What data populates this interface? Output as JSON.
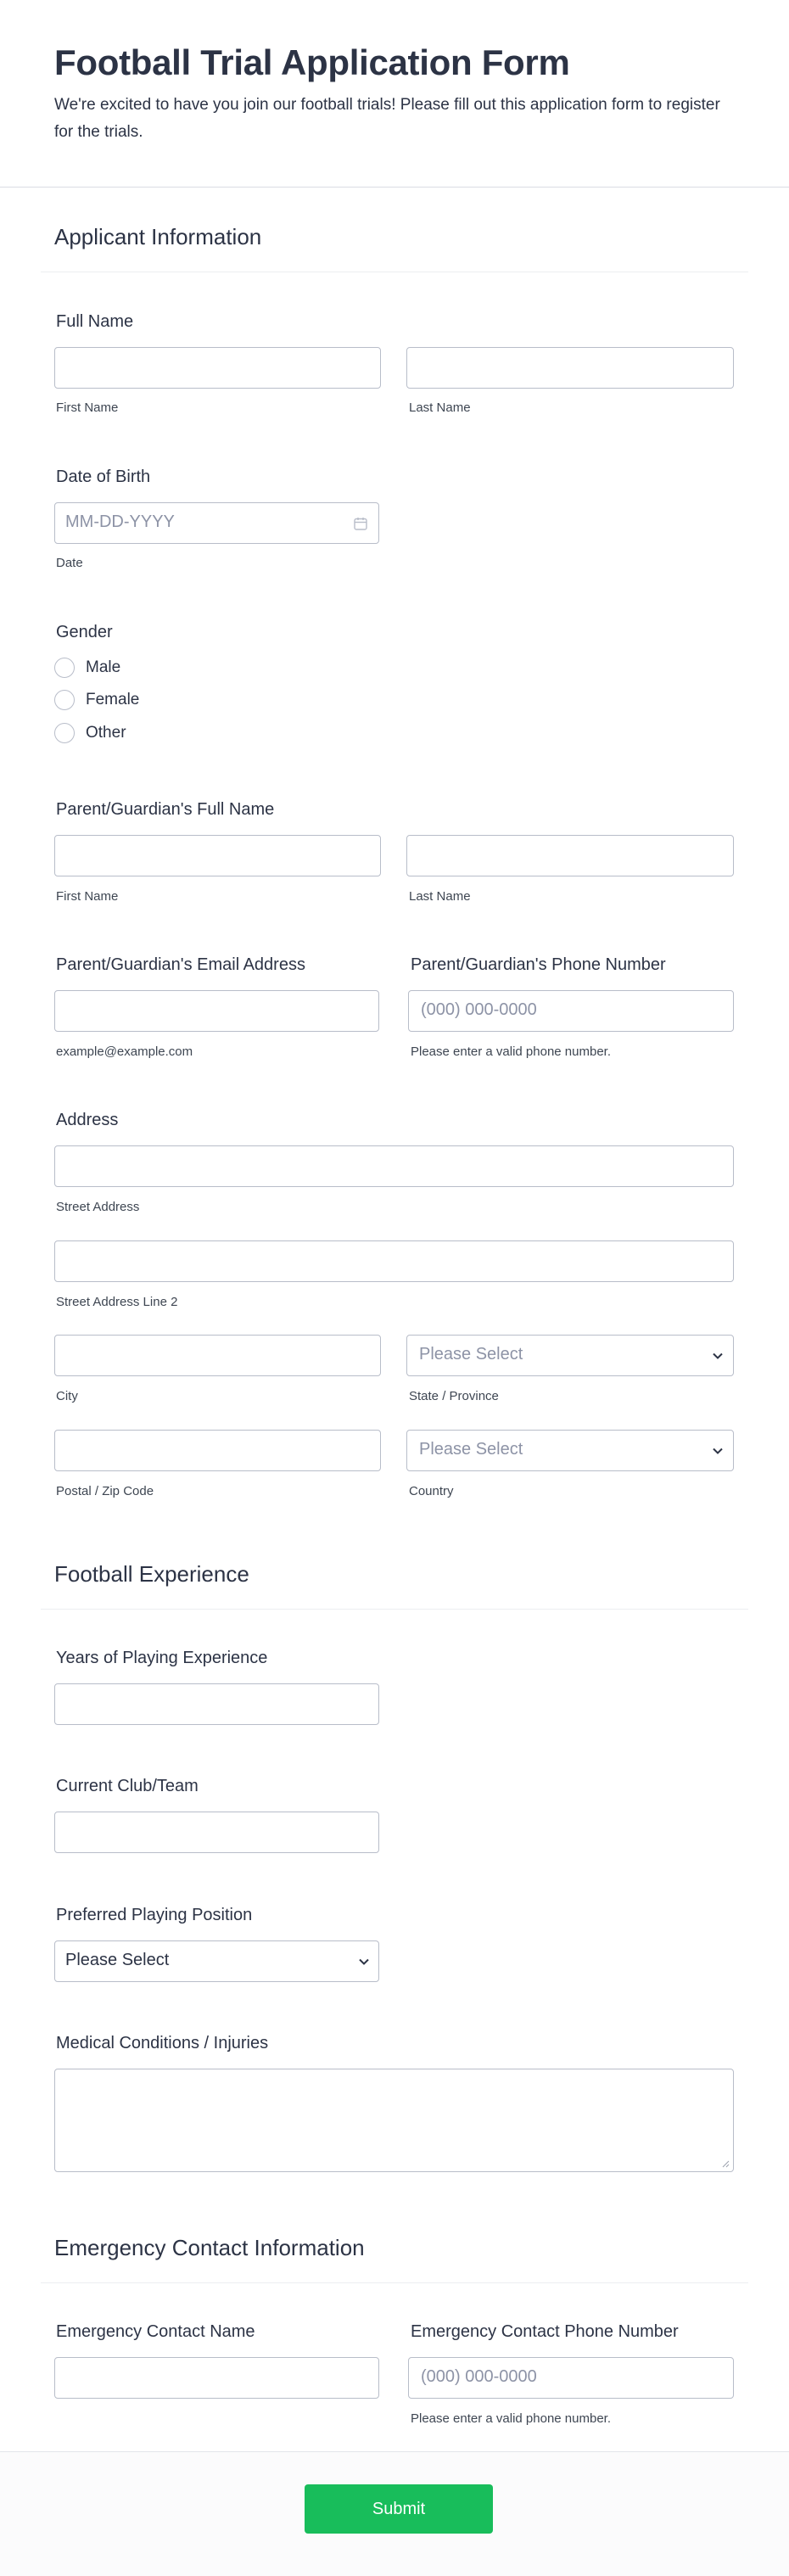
{
  "form": {
    "title": "Football Trial Application Form",
    "description": "We're excited to have you join our football trials! Please fill out this application form to register for the trials."
  },
  "sections": {
    "applicant": "Applicant Information",
    "football": "Football Experience",
    "emergency": "Emergency Contact Information"
  },
  "fields": {
    "full_name": {
      "label": "Full Name",
      "first": "First Name",
      "last": "Last Name"
    },
    "dob": {
      "label": "Date of Birth",
      "placeholder": "MM-DD-YYYY",
      "sublabel": "Date"
    },
    "gender": {
      "label": "Gender",
      "options": [
        "Male",
        "Female",
        "Other"
      ]
    },
    "guardian_name": {
      "label": "Parent/Guardian's Full Name",
      "first": "First Name",
      "last": "Last Name"
    },
    "guardian_email": {
      "label": "Parent/Guardian's Email Address",
      "sublabel": "example@example.com"
    },
    "guardian_phone": {
      "label": "Parent/Guardian's Phone Number",
      "placeholder": "(000) 000-0000",
      "sublabel": "Please enter a valid phone number."
    },
    "address": {
      "label": "Address",
      "street": "Street Address",
      "street2": "Street Address Line 2",
      "city": "City",
      "state": "State / Province",
      "state_placeholder": "Please Select",
      "zip": "Postal / Zip Code",
      "country": "Country",
      "country_placeholder": "Please Select"
    },
    "years_exp": {
      "label": "Years of Playing Experience"
    },
    "club": {
      "label": "Current Club/Team"
    },
    "position": {
      "label": "Preferred Playing Position",
      "value": "Please Select"
    },
    "medical": {
      "label": "Medical Conditions / Injuries"
    },
    "emergency_name": {
      "label": "Emergency Contact Name"
    },
    "emergency_phone": {
      "label": "Emergency Contact Phone Number",
      "placeholder": "(000) 000-0000",
      "sublabel": "Please enter a valid phone number."
    }
  },
  "submit": {
    "label": "Submit",
    "color": "#18bd5b"
  }
}
